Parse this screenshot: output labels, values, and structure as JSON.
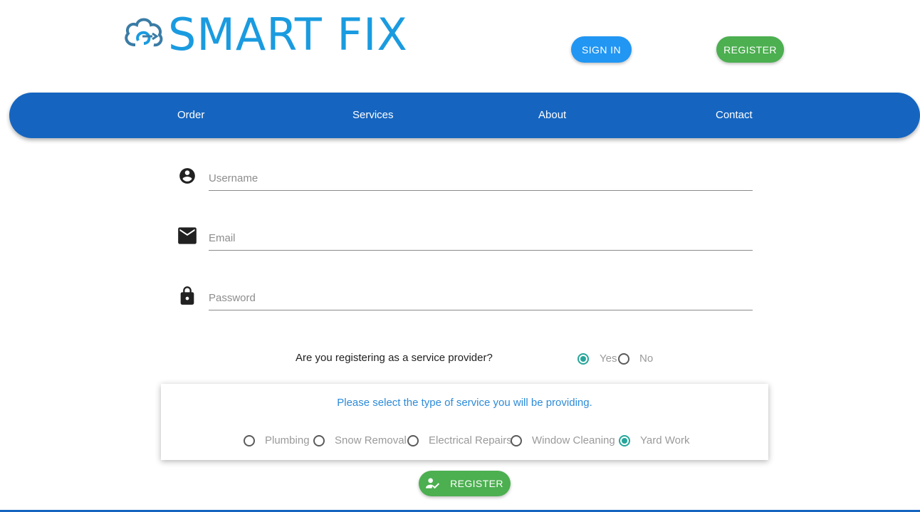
{
  "header": {
    "brand": "SMART FIX",
    "logo_icon": "cloud-wrench-icon",
    "signin_label": "SIGN IN",
    "register_label": "REGISTER"
  },
  "nav": {
    "items": [
      {
        "label": "Order"
      },
      {
        "label": "Services"
      },
      {
        "label": "About"
      },
      {
        "label": "Contact"
      }
    ]
  },
  "form": {
    "username": {
      "placeholder": "Username",
      "value": "",
      "icon": "account-circle-icon"
    },
    "email": {
      "placeholder": "Email",
      "value": "",
      "icon": "mail-icon"
    },
    "password": {
      "placeholder": "Password",
      "value": "",
      "icon": "lock-icon"
    },
    "provider_question": "Are you registering as a service provider?",
    "provider_options": [
      {
        "label": "Yes",
        "selected": true
      },
      {
        "label": "No",
        "selected": false
      }
    ],
    "service_prompt": "Please select the type of service you will be providing.",
    "services": [
      {
        "label": "Plumbing",
        "selected": false
      },
      {
        "label": "Snow Removal",
        "selected": false
      },
      {
        "label": "Electrical Repairs",
        "selected": false
      },
      {
        "label": "Window Cleaning",
        "selected": false
      },
      {
        "label": "Yard Work",
        "selected": true
      }
    ],
    "submit_label": "REGISTER",
    "submit_icon": "person-check-icon"
  },
  "colors": {
    "brand": "#1a9be0",
    "nav": "#1565c0",
    "signin": "#2196f3",
    "register": "#4caf50",
    "radio_selected": "#26a69a",
    "prompt_text": "#2c8bd8"
  }
}
